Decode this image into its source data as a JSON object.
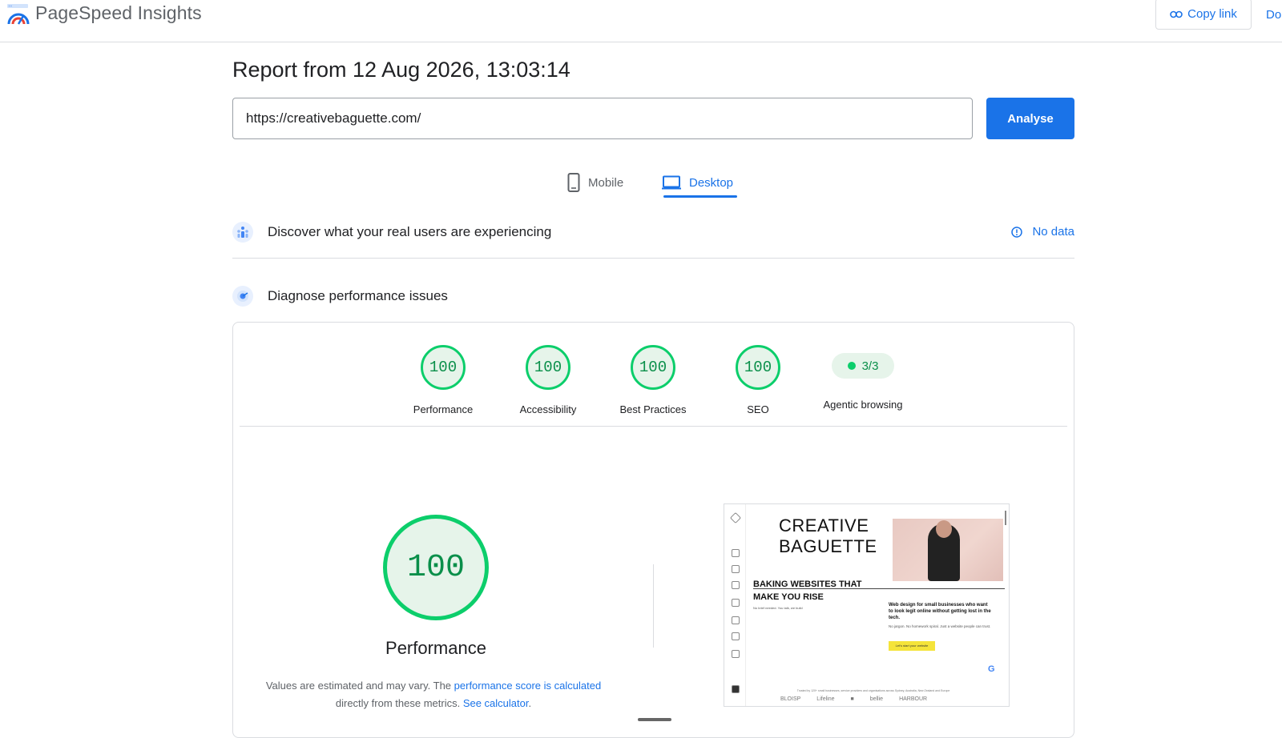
{
  "header": {
    "app_title": "PageSpeed Insights",
    "copy_link": "Copy link",
    "docs": "Do"
  },
  "report": {
    "title": "Report from 12 Aug 2026, 13:03:14",
    "url_value": "https://creativebaguette.com/",
    "analyse_label": "Analyse"
  },
  "tabs": [
    {
      "label": "Mobile",
      "active": false
    },
    {
      "label": "Desktop",
      "active": true
    }
  ],
  "field_data": {
    "title": "Discover what your real users are experiencing",
    "status": "No data"
  },
  "diagnose": {
    "title": "Diagnose performance issues"
  },
  "scores": [
    {
      "label": "Performance",
      "value": "100"
    },
    {
      "label": "Accessibility",
      "value": "100"
    },
    {
      "label": "Best Practices",
      "value": "100"
    },
    {
      "label": "SEO",
      "value": "100"
    }
  ],
  "agentic": {
    "label": "Agentic browsing",
    "value": "3/3"
  },
  "performance": {
    "score": "100",
    "label": "Performance",
    "note_prefix": "Values are estimated and may vary. The ",
    "note_link1": "performance score is calculated",
    "note_middle": " directly from these metrics. ",
    "note_link2": "See calculator",
    "note_suffix": "."
  },
  "thumbnail": {
    "brand_line1": "CREATIVE",
    "brand_line2": "BAGUETTE",
    "headline_line1": "BAKING WEBSITES THAT",
    "headline_line2": "MAKE YOU RISE",
    "small": "No brief needed. You talk, we build",
    "copy": "Web design for small businesses who want to look legit online without getting lost in the tech.",
    "copy2": "No jargon. No homework spiral. Just a website people can trust.",
    "cta": "Let's start your website",
    "footer": "Trusted by 120+ small businesses, service providers and organisations across Sydney, Australia, New Zealand and Europe",
    "logos": [
      "BLOISP",
      "Lifeline",
      "■",
      "bellie",
      "HARBOUR"
    ]
  },
  "colors": {
    "accent": "#1a73e8",
    "pass_green": "#0cce6b",
    "pass_text": "#0a8f4a",
    "pass_bg": "#e6f4ea"
  }
}
